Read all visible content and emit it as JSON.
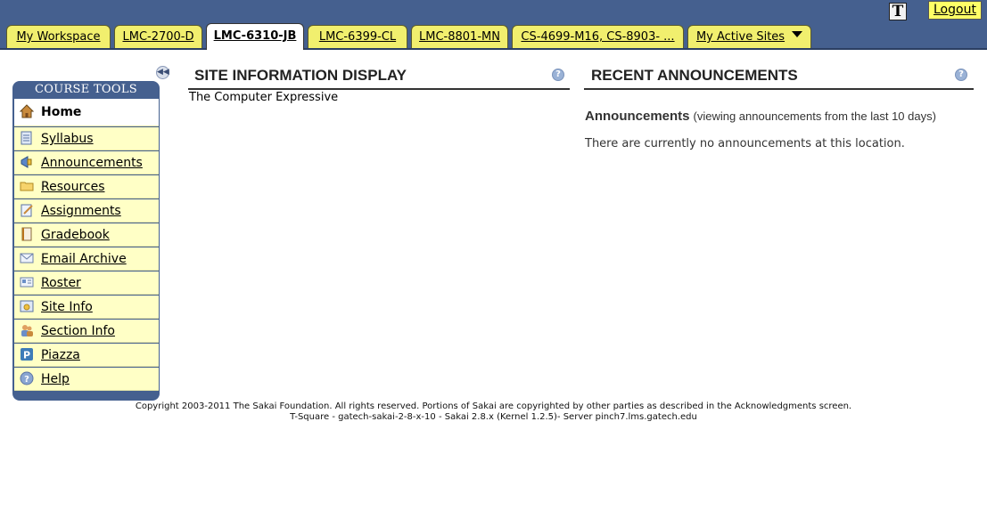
{
  "header": {
    "text_only_label": "T",
    "logout_label": "Logout",
    "tabs": [
      {
        "label": "My Workspace"
      },
      {
        "label": "LMC-2700-D"
      },
      {
        "label": "LMC-6310-JB",
        "active": true
      },
      {
        "label": "LMC-6399-CL"
      },
      {
        "label": "LMC-8801-MN"
      },
      {
        "label": "CS-4699-M16, CS-8903- ..."
      },
      {
        "label": "My Active Sites"
      }
    ]
  },
  "sidebar": {
    "title": "COURSE TOOLS",
    "items": [
      {
        "label": "Home",
        "icon": "home-icon"
      },
      {
        "label": "Syllabus",
        "icon": "syllabus-icon"
      },
      {
        "label": "Announcements",
        "icon": "megaphone-icon"
      },
      {
        "label": "Resources",
        "icon": "folder-icon"
      },
      {
        "label": "Assignments",
        "icon": "assignment-icon"
      },
      {
        "label": "Gradebook",
        "icon": "gradebook-icon"
      },
      {
        "label": "Email Archive",
        "icon": "envelope-icon"
      },
      {
        "label": "Roster",
        "icon": "roster-icon"
      },
      {
        "label": "Site Info",
        "icon": "site-info-icon"
      },
      {
        "label": "Section Info",
        "icon": "people-icon"
      },
      {
        "label": "Piazza",
        "icon": "piazza-icon"
      },
      {
        "label": "Help",
        "icon": "help-icon"
      }
    ]
  },
  "site_info": {
    "title": "SITE INFORMATION DISPLAY",
    "description": "The Computer Expressive"
  },
  "announcements": {
    "title": "RECENT ANNOUNCEMENTS",
    "heading": "Announcements",
    "subheading": "(viewing announcements from the last 10 days)",
    "empty_message": "There are currently no announcements at this location."
  },
  "footer": {
    "line1": "Copyright 2003-2011 The Sakai Foundation. All rights reserved. Portions of Sakai are copyrighted by other parties as described in the Acknowledgments screen.",
    "line2": "T-Square - gatech-sakai-2-8-x-10 - Sakai 2.8.x (Kernel 1.2.5)- Server pinch7.lms.gatech.edu"
  },
  "colors": {
    "header_bg": "#45608f",
    "tab_bg": "#f1ef6e",
    "tool_item_bg": "#ffffc6",
    "logout_bg": "#ffff66"
  }
}
